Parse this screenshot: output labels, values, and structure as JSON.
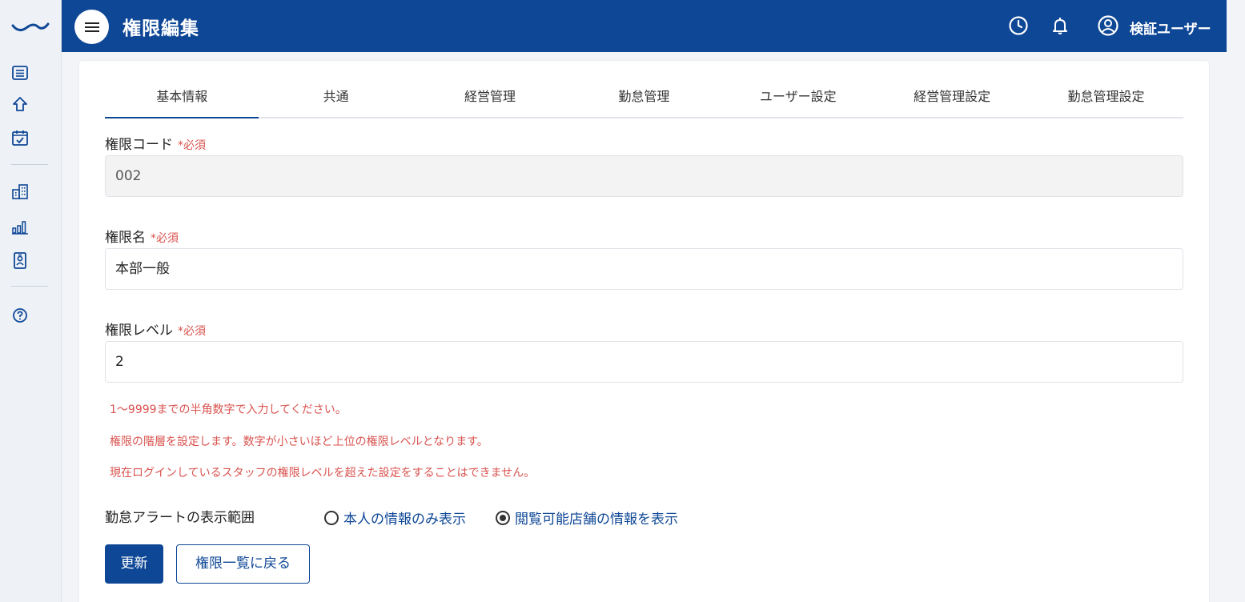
{
  "header": {
    "title": "権限編集",
    "user_name": "検証ユーザー"
  },
  "sidebar": {
    "items": [
      {
        "icon": "list-icon"
      },
      {
        "icon": "home-icon"
      },
      {
        "icon": "calendar-check-icon"
      },
      {
        "icon": "building-icon"
      },
      {
        "icon": "bar-chart-icon"
      },
      {
        "icon": "id-badge-icon"
      },
      {
        "icon": "help-icon"
      }
    ]
  },
  "tabs": [
    {
      "label": "基本情報",
      "active": true
    },
    {
      "label": "共通"
    },
    {
      "label": "経営管理"
    },
    {
      "label": "勤怠管理"
    },
    {
      "label": "ユーザー設定"
    },
    {
      "label": "経営管理設定"
    },
    {
      "label": "勤怠管理設定"
    }
  ],
  "form": {
    "code": {
      "label": "権限コード",
      "required": "*必須",
      "value": "002"
    },
    "name": {
      "label": "権限名",
      "required": "*必須",
      "value": "本部一般"
    },
    "level": {
      "label": "権限レベル",
      "required": "*必須",
      "value": "2"
    },
    "hints": [
      "1〜9999までの半角数字で入力してください。",
      "権限の階層を設定します。数字が小さいほど上位の権限レベルとなります。",
      "現在ログインしているスタッフの権限レベルを超えた設定をすることはできません。"
    ],
    "alert_scope": {
      "label": "勤怠アラートの表示範囲",
      "options": [
        {
          "label": "本人の情報のみ表示",
          "checked": false
        },
        {
          "label": "閲覧可能店舗の情報を表示",
          "checked": true
        }
      ]
    }
  },
  "buttons": {
    "update": "更新",
    "back": "権限一覧に戻る"
  },
  "colors": {
    "brand": "#0e4796",
    "required": "#d9534f"
  }
}
